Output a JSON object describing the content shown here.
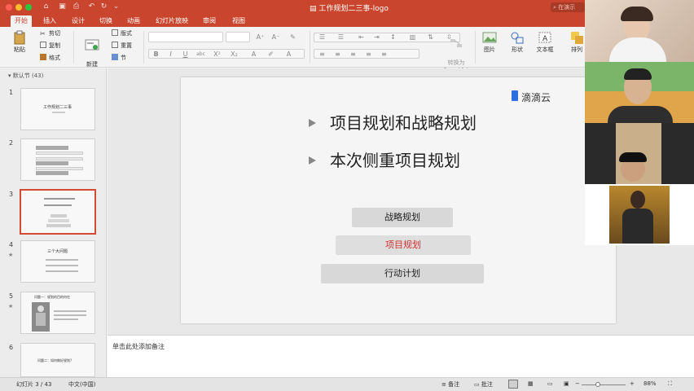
{
  "window": {
    "title": "工作规划二三事-logo",
    "search_placeholder": "在演示"
  },
  "tabs": [
    "开始",
    "插入",
    "设计",
    "切换",
    "动画",
    "幻灯片放映",
    "审阅",
    "视图"
  ],
  "ribbon": {
    "paste": "粘贴",
    "cut": "剪切",
    "copy": "复制",
    "format": "格式",
    "new_slide": "新建\n幻灯片",
    "layout": "版式",
    "reset": "重置",
    "section": "节",
    "convert_smartart": "转换为\nSmartArt",
    "picture": "图片",
    "shape": "形状",
    "textbox": "文本框",
    "arrange": "排列"
  },
  "slide_panel": {
    "section_label": "默认节 (43)",
    "thumbnails": [
      {
        "num": "1",
        "title": "工作规划二三事"
      },
      {
        "num": "2",
        "title": ""
      },
      {
        "num": "3",
        "title": ""
      },
      {
        "num": "4",
        "title": "三个大问题"
      },
      {
        "num": "5",
        "title": "问题一：规划的目的何在"
      },
      {
        "num": "6",
        "title": "问题二：如何做好规划?"
      }
    ]
  },
  "slide": {
    "logo": "滴滴云",
    "bullets": [
      "项目规划和战略规划",
      "本次侧重项目规划"
    ],
    "pills": [
      "战略规划",
      "项目规划",
      "行动计划"
    ]
  },
  "notes": {
    "placeholder": "单击此处添加备注"
  },
  "status": {
    "slide_indicator": "幻灯片 3 / 43",
    "language": "中文(中国)",
    "notes_btn": "备注",
    "comments_btn": "批注",
    "zoom": "88%"
  },
  "colors": {
    "accent": "#c9452e",
    "active_thumb_border": "#d24a32",
    "highlight_text": "#d03030"
  }
}
